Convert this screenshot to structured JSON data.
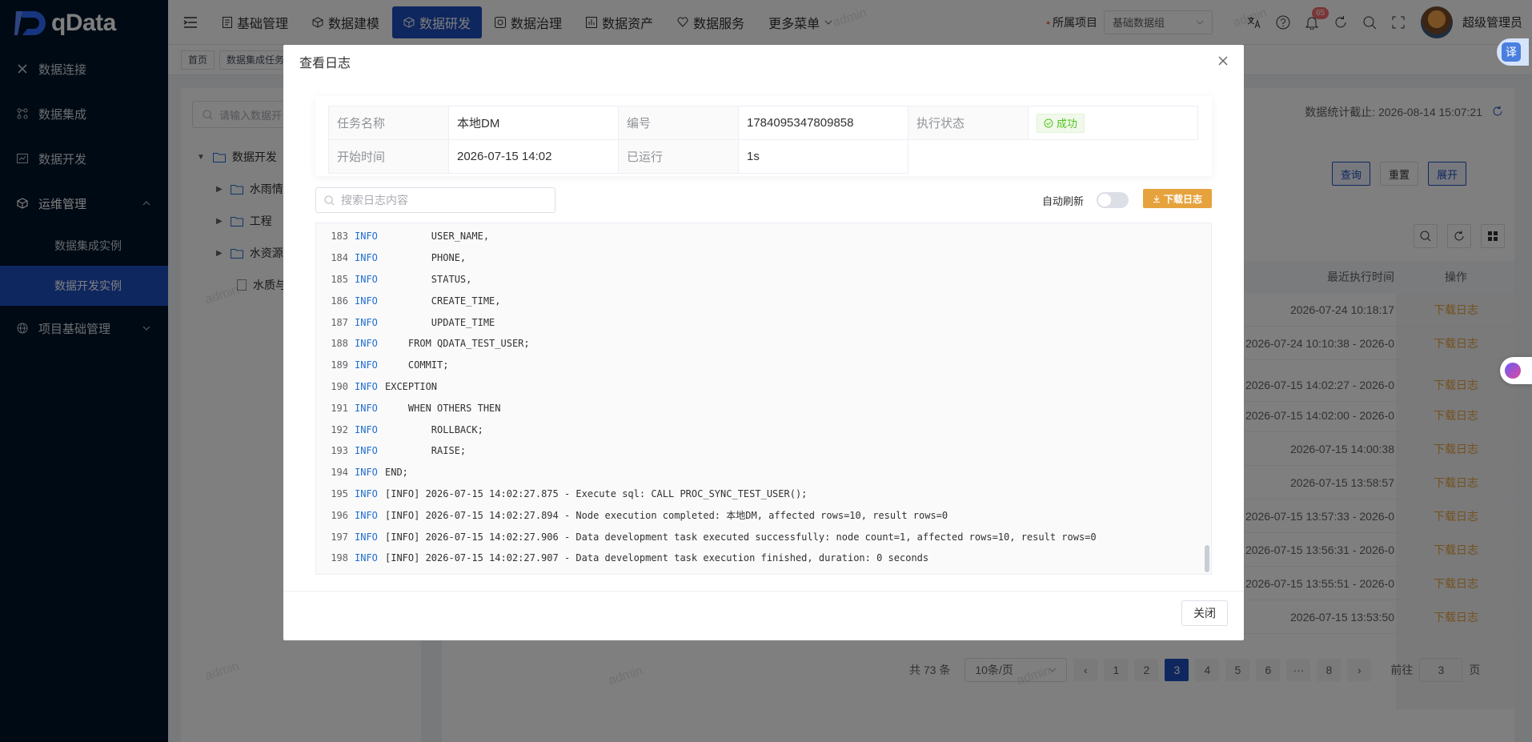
{
  "app": {
    "logo_text": "qData"
  },
  "sidebar": {
    "items": [
      {
        "label": "数据连接"
      },
      {
        "label": "数据集成"
      },
      {
        "label": "数据开发"
      },
      {
        "label": "运维管理"
      },
      {
        "label": "数据集成实例"
      },
      {
        "label": "数据开发实例"
      },
      {
        "label": "项目基础管理"
      }
    ]
  },
  "header": {
    "nav": [
      {
        "label": "基础管理"
      },
      {
        "label": "数据建模"
      },
      {
        "label": "数据研发"
      },
      {
        "label": "数据治理"
      },
      {
        "label": "数据资产"
      },
      {
        "label": "数据服务"
      },
      {
        "label": "更多菜单"
      }
    ],
    "project_label": "所属项目",
    "project_value": "基础数据组",
    "notification_count": "65",
    "user_name": "超级管理员"
  },
  "tabs": [
    {
      "label": "首页"
    },
    {
      "label": "数据集成任务"
    }
  ],
  "background": {
    "search_placeholder": "请输入数据开",
    "tree": [
      {
        "label": "数据开发"
      },
      {
        "label": "水雨情"
      },
      {
        "label": "工程"
      },
      {
        "label": "水资源"
      },
      {
        "label": "水质与"
      }
    ],
    "stat_time": "数据统计截止: 2026-08-14 15:07:21",
    "buttons": {
      "query": "查询",
      "reset": "重置",
      "expand": "展开"
    },
    "table_headers": {
      "time": "最近执行时间",
      "op": "操作"
    },
    "rows": [
      {
        "time": "2026-07-24 10:18:17",
        "op": "下载日志"
      },
      {
        "time": "2026-07-24 10:10:38 - 2026-0",
        "op": "下载日志"
      },
      {
        "time": "2026-07-15 14:02:27 - 2026-0",
        "op": "下载日志"
      },
      {
        "time": "2026-07-15 14:02:00 - 2026-0",
        "op": "下载日志"
      },
      {
        "time": "2026-07-15 14:00:38",
        "op": "下载日志"
      },
      {
        "time": "2026-07-15 13:58:57",
        "op": "下载日志"
      },
      {
        "time": "2026-07-15 13:57:33 - 2026-0",
        "op": "下载日志"
      },
      {
        "time": "2026-07-15 13:56:31 - 2026-0",
        "op": "下载日志"
      },
      {
        "time": "2026-07-15 13:55:51 - 2026-0",
        "op": "下载日志"
      },
      {
        "time": "2026-07-15 13:53:50",
        "op": "下载日志"
      }
    ],
    "pager": {
      "total": "共 73 条",
      "page_size": "10条/页",
      "pages": [
        "1",
        "2",
        "3",
        "4",
        "5",
        "6",
        "···",
        "8"
      ],
      "goto_label": "前往",
      "goto_value": "3",
      "page_unit": "页"
    },
    "watermark": "admin"
  },
  "dialog": {
    "title": "查看日志",
    "info": {
      "task_name_label": "任务名称",
      "task_name": "本地DM",
      "id_label": "编号",
      "id": "1784095347809858",
      "status_label": "执行状态",
      "status": "成功",
      "start_label": "开始时间",
      "start": "2026-07-15 14:02",
      "elapsed_label": "已运行",
      "elapsed": "1s"
    },
    "search_placeholder": "搜索日志内容",
    "auto_refresh_label": "自动刷新",
    "download_label": "下载日志",
    "log_lines": [
      {
        "num": "183",
        "level": "INFO",
        "text": "        USER_NAME,"
      },
      {
        "num": "184",
        "level": "INFO",
        "text": "        PHONE,"
      },
      {
        "num": "185",
        "level": "INFO",
        "text": "        STATUS,"
      },
      {
        "num": "186",
        "level": "INFO",
        "text": "        CREATE_TIME,"
      },
      {
        "num": "187",
        "level": "INFO",
        "text": "        UPDATE_TIME"
      },
      {
        "num": "188",
        "level": "INFO",
        "text": "    FROM QDATA_TEST_USER;"
      },
      {
        "num": "189",
        "level": "INFO",
        "text": "    COMMIT;"
      },
      {
        "num": "190",
        "level": "INFO",
        "text": "EXCEPTION"
      },
      {
        "num": "191",
        "level": "INFO",
        "text": "    WHEN OTHERS THEN"
      },
      {
        "num": "192",
        "level": "INFO",
        "text": "        ROLLBACK;"
      },
      {
        "num": "193",
        "level": "INFO",
        "text": "        RAISE;"
      },
      {
        "num": "194",
        "level": "INFO",
        "text": "END;"
      },
      {
        "num": "195",
        "level": "INFO",
        "text": "[INFO] 2026-07-15 14:02:27.875 - Execute sql: CALL PROC_SYNC_TEST_USER();"
      },
      {
        "num": "196",
        "level": "INFO",
        "text": "[INFO] 2026-07-15 14:02:27.894 - Node execution completed: 本地DM, affected rows=10, result rows=0"
      },
      {
        "num": "197",
        "level": "INFO",
        "text": "[INFO] 2026-07-15 14:02:27.906 - Data development task executed successfully: node count=1, affected rows=10, result rows=0"
      },
      {
        "num": "198",
        "level": "INFO",
        "text": "[INFO] 2026-07-15 14:02:27.907 - Data development task execution finished, duration: 0 seconds"
      }
    ],
    "close_label": "关闭"
  },
  "widgets": {
    "translate": "译"
  },
  "colors": {
    "primary": "#1f4fbf",
    "warning": "#e6a23c",
    "success": "#52c41a",
    "sidebar": "#001529"
  }
}
